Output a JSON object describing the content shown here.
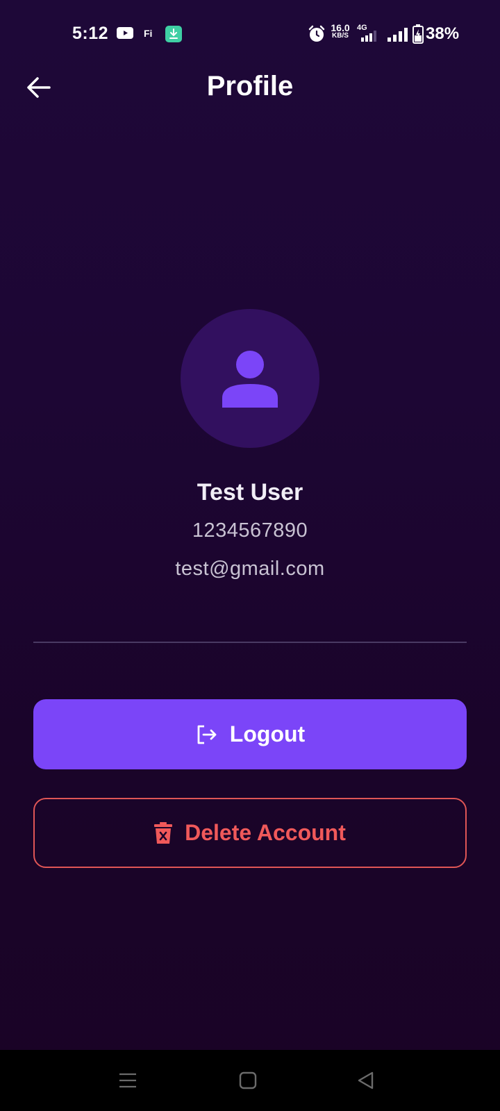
{
  "status_bar": {
    "time": "5:12",
    "net_speed_value": "16.0",
    "net_speed_unit": "KB/S",
    "network_type": "4G",
    "battery_percent": "38%",
    "icons": [
      "youtube-icon",
      "fi-app-icon",
      "download-icon",
      "alarm-icon",
      "signal-icon",
      "signal-icon",
      "battery-charging-icon"
    ]
  },
  "header": {
    "title": "Profile",
    "back_icon": "arrow-left-icon"
  },
  "profile": {
    "avatar_icon": "person-icon",
    "name": "Test User",
    "phone": "1234567890",
    "email": "test@gmail.com"
  },
  "actions": {
    "logout_label": "Logout",
    "logout_icon": "logout-icon",
    "delete_label": "Delete Account",
    "delete_icon": "trash-icon"
  },
  "colors": {
    "background": "#1d0634",
    "accent": "#7b45f8",
    "danger": "#f0595a",
    "avatar_bg": "#32105f",
    "avatar_icon": "#7b45f8"
  },
  "nav_bar": {
    "icons": [
      "menu-icon",
      "home-square-icon",
      "back-triangle-icon"
    ]
  }
}
